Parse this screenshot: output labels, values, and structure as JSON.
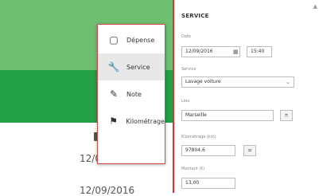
{
  "menu": {
    "items": [
      {
        "label": "Dépense",
        "icon": "receipt-icon"
      },
      {
        "label": "Service",
        "icon": "wrench-icon"
      },
      {
        "label": "Note",
        "icon": "pencil-icon"
      },
      {
        "label": "Kilométrage",
        "icon": "flag-icon"
      }
    ],
    "selected": "Service"
  },
  "toolbar": {
    "icons": [
      "fuel-icon",
      "add-icon",
      "filter-icon"
    ]
  },
  "list": {
    "dates": [
      "12/09/2016",
      "12/09/2016"
    ]
  },
  "form": {
    "title": "SERVICE",
    "date_label": "Date",
    "date_value": "12/09/2016",
    "time_value": "15:40",
    "service_label": "Service",
    "service_value": "Lavage voiture",
    "lieu_label": "Lieu",
    "lieu_value": "Marseille",
    "km_label": "Kilométrage (km)",
    "km_value": "97804,6",
    "montant_label": "Montant (€)",
    "montant_value": "13,00"
  },
  "colors": {
    "green_light": "#6fbf73",
    "green_dark": "#24a046",
    "accent_red": "#cf3a3a"
  }
}
